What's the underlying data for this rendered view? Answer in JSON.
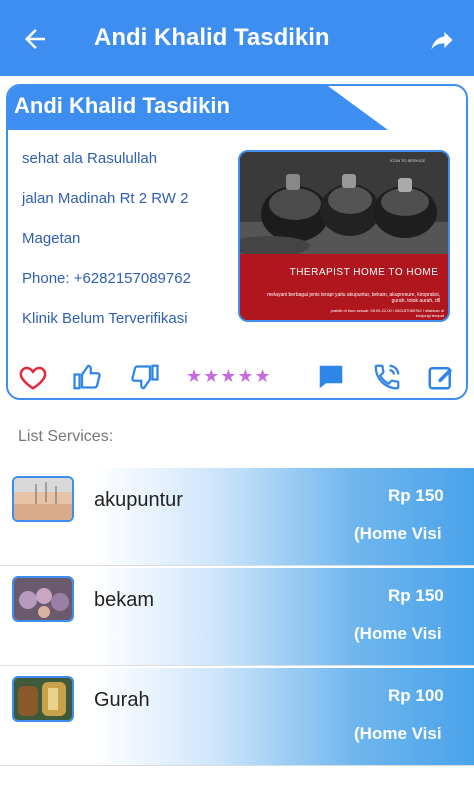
{
  "header": {
    "title": "Andi Khalid Tasdikin",
    "back_icon": "arrow-back-icon",
    "share_icon": "share-icon",
    "color": "#3d8ef0"
  },
  "profile": {
    "name": "Andi Khalid Tasdikin",
    "tagline": "sehat ala Rasulullah",
    "address": "jalan Madinah Rt 2 RW 2",
    "city": "Magetan",
    "phone": "Phone: +6282157089762",
    "status": "Klinik Belum Terverifikasi",
    "photo": {
      "top_text": "ICON TO SERVICE",
      "title": "THERAPIST HOME TO HOME",
      "text": "melayani berbagai jenis terapi yaitu akupuntur, bekam, akupresure, kiropraksi, gurah, totok aurah, dll",
      "footer": "praktik di tiuru sesuai: 08.00-22.00 / 082157089762 / silahkan di kunjungi tempat"
    }
  },
  "actions": {
    "rating": 5,
    "stars": "★★★★★",
    "icons": [
      "heart-icon",
      "thumbs-up-icon",
      "thumbs-down-icon",
      "star-rating-icon",
      "comment-icon",
      "phone-call-icon",
      "edit-icon"
    ],
    "colors": {
      "heart": "#e0293a",
      "primary": "#2f86e8",
      "stars": "#c86ae0"
    }
  },
  "services": {
    "title": "List Services:",
    "items": [
      {
        "name": "akupuntur",
        "price": "Rp 150",
        "visit": "(Home Visi"
      },
      {
        "name": "bekam",
        "price": "Rp 150",
        "visit": "(Home Visi"
      },
      {
        "name": "Gurah",
        "price": "Rp 100",
        "visit": "(Home Visi"
      }
    ]
  }
}
